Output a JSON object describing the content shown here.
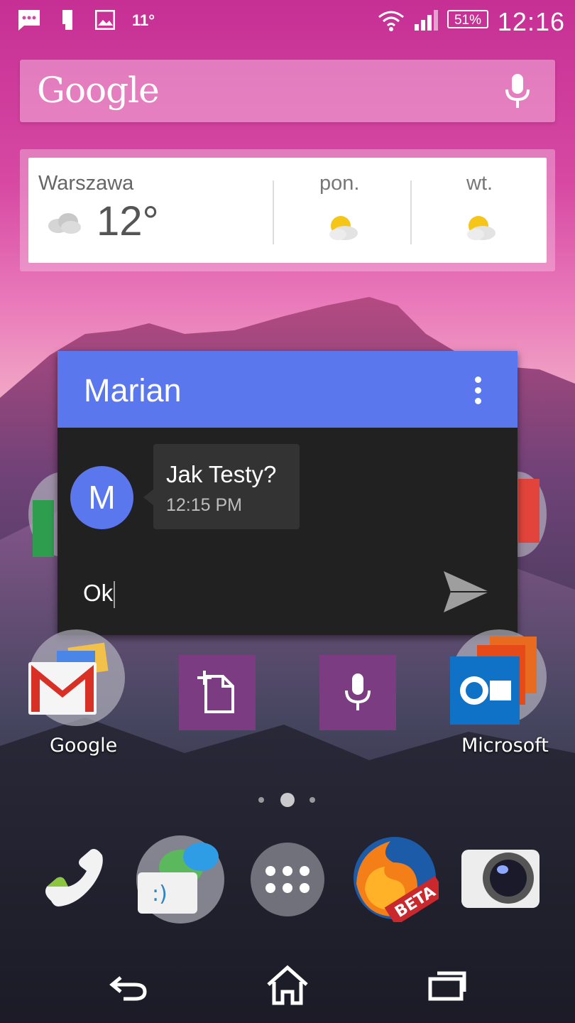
{
  "status_bar": {
    "temperature": "11°",
    "battery": "51%",
    "time": "12:16",
    "icons": [
      "sms-notification-icon",
      "usb-debug-icon",
      "image-notification-icon",
      "wifi-icon",
      "signal-icon",
      "battery-icon"
    ]
  },
  "search": {
    "logo_text": "Google",
    "mic_icon": "microphone-icon"
  },
  "weather": {
    "city": "Warszawa",
    "current_temp": "12°",
    "current_icon": "cloudy-icon",
    "forecast": [
      {
        "day": "pon.",
        "icon": "partly-sunny-icon"
      },
      {
        "day": "wt.",
        "icon": "partly-sunny-icon"
      }
    ]
  },
  "message_popup": {
    "contact_name": "Marian",
    "avatar_letter": "M",
    "message_text": "Jak Testy?",
    "message_time": "12:15 PM",
    "reply_text": "Ok",
    "accent_color": "#5a77ed"
  },
  "home_icons": {
    "google_folder_label": "Google",
    "microsoft_folder_label": "Microsoft",
    "new_note_icon": "new-note-icon",
    "voice_icon": "microphone-icon"
  },
  "dock": [
    "phone-icon",
    "messaging-icon",
    "app-drawer-icon",
    "firefox-beta-icon",
    "camera-icon"
  ],
  "firefox_badge": "BETA",
  "navigation": [
    "back-icon",
    "home-icon",
    "recent-apps-icon"
  ]
}
